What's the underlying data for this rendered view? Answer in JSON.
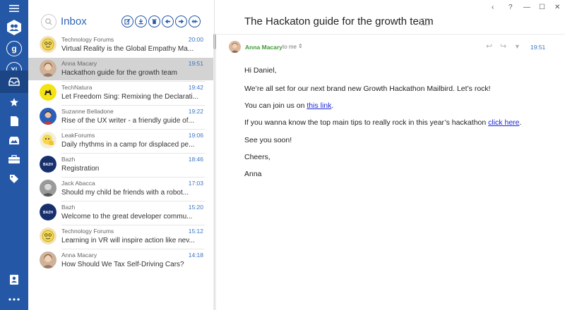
{
  "rail": {
    "accent": "#2458a6",
    "items": [
      {
        "name": "menu",
        "glyph": "≡"
      },
      {
        "name": "all-accounts",
        "glyph": "👥"
      },
      {
        "name": "google-account",
        "glyph": "g"
      },
      {
        "name": "yahoo-account",
        "glyph": "Y!"
      },
      {
        "name": "inbox",
        "glyph": "▭"
      },
      {
        "name": "starred",
        "glyph": "★"
      },
      {
        "name": "drafts",
        "glyph": "▮"
      },
      {
        "name": "archive",
        "glyph": "⛰"
      },
      {
        "name": "work",
        "glyph": "▣"
      },
      {
        "name": "tags",
        "glyph": "⬗"
      },
      {
        "name": "contacts",
        "glyph": "▤"
      },
      {
        "name": "more",
        "glyph": "•••"
      }
    ]
  },
  "list": {
    "title": "Inbox",
    "toolbar": [
      "compose",
      "download",
      "delete",
      "reply",
      "forward",
      "reply-all"
    ],
    "emails": [
      {
        "sender": "Technology Forums",
        "subject": "Virtual Reality is the Global Empathy Ma...",
        "time": "20:00",
        "avatar": "emoji-yellow"
      },
      {
        "sender": "Anna Macary",
        "subject": "Hackathon guide for the growth team",
        "time": "19:51",
        "avatar": "photo-woman"
      },
      {
        "sender": "TechNatura",
        "subject": "Let Freedom Sing: Remixing the Declarati...",
        "time": "19:42",
        "avatar": "yellow-logo"
      },
      {
        "sender": "Suzanne Belladone",
        "subject": "Rise of the UX writer - a friendly guide of...",
        "time": "19:22",
        "avatar": "photo-blue"
      },
      {
        "sender": "LeakForums",
        "subject": "Daily rhythms in a camp for displaced pe...",
        "time": "19:06",
        "avatar": "emoji-hand"
      },
      {
        "sender": "Bazh",
        "subject": "Registration",
        "time": "18:46",
        "avatar": "bazh-logo"
      },
      {
        "sender": "Jack Abacca",
        "subject": "Should my child be friends with a robot...",
        "time": "17:03",
        "avatar": "photo-man"
      },
      {
        "sender": "Bazh",
        "subject": "Welcome to the great developer commu...",
        "time": "15:20",
        "avatar": "bazh-logo"
      },
      {
        "sender": "Technology Forums",
        "subject": "Learning in VR will inspire action like nev...",
        "time": "15:12",
        "avatar": "emoji-yellow"
      },
      {
        "sender": "Anna Macary",
        "subject": "How Should We Tax Self-Driving Cars?",
        "time": "14:18",
        "avatar": "photo-woman"
      }
    ],
    "bazh_label": "BAZH"
  },
  "window": {
    "back": "‹",
    "help": "?",
    "minimize": "—",
    "maximize": "☐",
    "close": "✕"
  },
  "message": {
    "subject": "The Hackaton guide for the growth team",
    "from": "Anna Macary",
    "to": "to me",
    "time": "19:51",
    "greeting": "Hi Daniel,",
    "line1": "We’re all set for our next brand new Growth Hackathon Mailbird. Let’s rock!",
    "line2_pre": "You can join us on ",
    "line2_link": "this link",
    "line2_post": ".",
    "line3_pre": "If you wanna know the top main tips to really rock in this year’s hackathon ",
    "line3_link": "click here",
    "line3_post": ".",
    "line4": "See you soon!",
    "sign1": "Cheers,",
    "sign2": "Anna"
  }
}
